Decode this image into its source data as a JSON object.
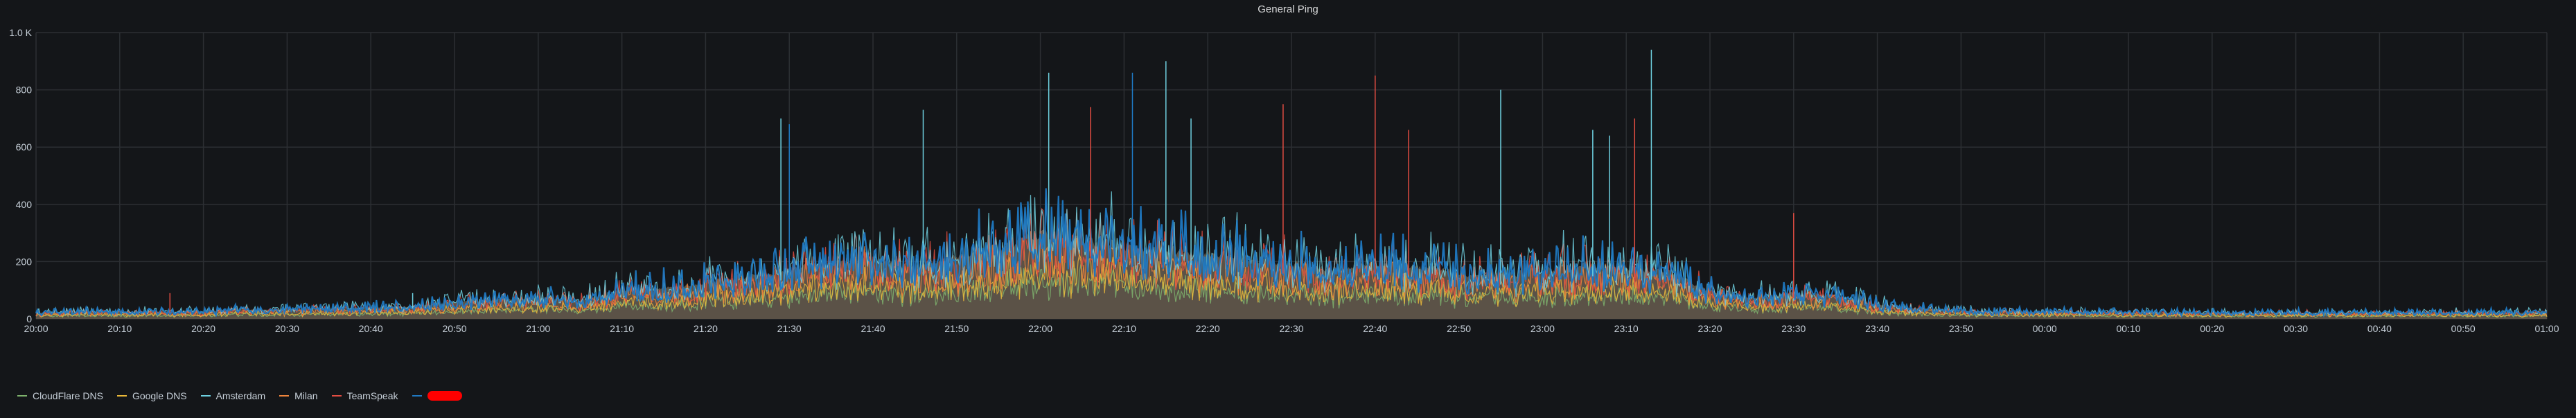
{
  "chart_data": {
    "type": "line",
    "title": "General Ping",
    "xlabel": "",
    "ylabel": "",
    "ylim": [
      0,
      1000
    ],
    "yticks": [
      "0",
      "200",
      "400",
      "600",
      "800",
      "1.0 K"
    ],
    "ytick_values": [
      0,
      200,
      400,
      600,
      800,
      1000
    ],
    "xticks": [
      "20:00",
      "20:10",
      "20:20",
      "20:30",
      "20:40",
      "20:50",
      "21:00",
      "21:10",
      "21:20",
      "21:30",
      "21:40",
      "21:50",
      "22:00",
      "22:10",
      "22:20",
      "22:30",
      "22:40",
      "22:50",
      "23:00",
      "23:10",
      "23:20",
      "23:30",
      "23:40",
      "23:50",
      "00:00",
      "00:10",
      "00:20",
      "00:30",
      "00:40",
      "00:50",
      "01:00"
    ],
    "x_interval_minutes": 5,
    "grid": true,
    "legend_position": "bottom-left",
    "series": [
      {
        "name": "CloudFlare DNS",
        "color": "#7eb26d",
        "scale": 0.45
      },
      {
        "name": "Google DNS",
        "color": "#eab839",
        "scale": 0.55
      },
      {
        "name": "Amsterdam",
        "color": "#6ed0e0",
        "scale": 1.05
      },
      {
        "name": "Milan",
        "color": "#ef843c",
        "scale": 0.75
      },
      {
        "name": "TeamSpeak",
        "color": "#e24d42",
        "scale": 0.9
      },
      {
        "name": "",
        "color": "#1f78c1",
        "scale": 1.0,
        "redacted": true
      }
    ],
    "envelope": [
      30,
      35,
      35,
      35,
      35,
      45,
      45,
      50,
      55,
      60,
      80,
      90,
      100,
      90,
      130,
      150,
      170,
      200,
      230,
      260,
      280,
      240,
      300,
      330,
      400,
      370,
      340,
      320,
      310,
      280,
      260,
      230,
      260,
      250,
      210,
      200,
      230,
      250,
      240,
      220,
      130,
      100,
      120,
      110,
      70,
      50,
      40,
      35,
      35,
      32,
      32,
      30,
      30,
      30,
      30,
      30,
      30,
      30,
      30,
      30,
      30
    ],
    "spikes": [
      {
        "minute": 89,
        "value": 700,
        "series": 2
      },
      {
        "minute": 90,
        "value": 680,
        "series": 5
      },
      {
        "minute": 106,
        "value": 730,
        "series": 2
      },
      {
        "minute": 121,
        "value": 860,
        "series": 2
      },
      {
        "minute": 126,
        "value": 740,
        "series": 4
      },
      {
        "minute": 131,
        "value": 860,
        "series": 5
      },
      {
        "minute": 135,
        "value": 900,
        "series": 2
      },
      {
        "minute": 138,
        "value": 700,
        "series": 2
      },
      {
        "minute": 149,
        "value": 750,
        "series": 4
      },
      {
        "minute": 160,
        "value": 850,
        "series": 4
      },
      {
        "minute": 164,
        "value": 660,
        "series": 4
      },
      {
        "minute": 175,
        "value": 800,
        "series": 2
      },
      {
        "minute": 186,
        "value": 660,
        "series": 2
      },
      {
        "minute": 188,
        "value": 640,
        "series": 2
      },
      {
        "minute": 191,
        "value": 700,
        "series": 4
      },
      {
        "minute": 193,
        "value": 940,
        "series": 2
      },
      {
        "minute": 210,
        "value": 370,
        "series": 4
      },
      {
        "minute": 16,
        "value": 90,
        "series": 4
      },
      {
        "minute": 45,
        "value": 90,
        "series": 2
      }
    ]
  }
}
